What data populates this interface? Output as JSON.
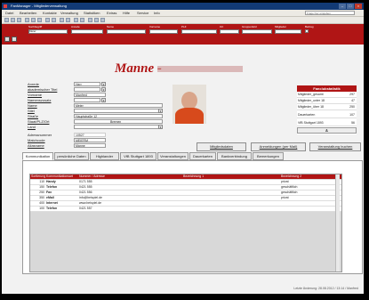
{
  "window": {
    "title": "FanManager - Mitgliederverwaltung"
  },
  "menu": [
    "Datei",
    "Bearbeiten",
    "Kontakte",
    "Verwaltung",
    "Statistiken",
    "Extras",
    "Hilfe",
    "Service",
    "Info"
  ],
  "help_placeholder": "Frage hier eingeben",
  "filters": {
    "labels": [
      "Suchbegriff",
      "Anrede",
      "Name",
      "Vorname",
      "PLZ",
      "Ort",
      "Gruppenfeld",
      "Mitglieder",
      "Beitrag"
    ],
    "values": [
      "Meier",
      "",
      "",
      "",
      "",
      "",
      "",
      "",
      ""
    ]
  },
  "header_title": "Manne -",
  "form": {
    "fields": [
      {
        "label": "Anrede",
        "value": "Herr"
      },
      {
        "label": "akademischer Titel",
        "value": ""
      },
      {
        "label": "Vorname",
        "value": "Manfred"
      },
      {
        "label": "Namenszusatz",
        "value": ""
      },
      {
        "label": "Name",
        "value": "Meier"
      },
      {
        "label": "Stiel",
        "value": ""
      },
      {
        "label": "Straße",
        "value": "Hauptstraße 12"
      },
      {
        "label": "Staat/PLZ/Ort",
        "value": "Bremen"
      },
      {
        "label": "Land",
        "value": ""
      }
    ],
    "extra": [
      {
        "label": "Adressnummer",
        "value": "10527"
      },
      {
        "label": "Matchcode",
        "value": "MEIERM"
      },
      {
        "label": "Aliasname",
        "value": "Manne"
      }
    ]
  },
  "fanclub": {
    "title": "Fanclubstatistik",
    "rows": [
      {
        "label": "Mitglieder_gesamt",
        "value": "297"
      },
      {
        "label": "Mitglieder_unter 18",
        "value": "47"
      },
      {
        "label": "Mitglieder_über 18",
        "value": "250"
      },
      {
        "label": "Dauerkarten",
        "value": "107"
      },
      {
        "label": "VfB Stuttgart 1893",
        "value": "56"
      }
    ],
    "button": "Ä"
  },
  "actions": [
    "Mitgliedsdaten",
    "Anmeldungen (per Mail)",
    "Veranstaltung buchen"
  ],
  "tabs": [
    "Kommunikation",
    "persönliche Daten",
    "Highlander",
    "VfB Stuttgart 1893",
    "Veranstaltungen",
    "Dauerkarten",
    "Bankverbindung",
    "Bemerkungen"
  ],
  "grid": {
    "headers": [
      "Sortierung",
      "Kommunikationsart",
      "Nummer / Adresse",
      "Bezeichnung 1",
      "Bezeichnung 2"
    ],
    "rows": [
      {
        "nr": "110",
        "type": "Handy",
        "addr": "0171 555",
        "b2": "privat"
      },
      {
        "nr": "150",
        "type": "Telefon",
        "addr": "0421 555",
        "b2": "geschäftlich"
      },
      {
        "nr": "250",
        "type": "Fax",
        "addr": "0421 556",
        "b2": "geschäftlich"
      },
      {
        "nr": "350",
        "type": "eMail",
        "addr": "info@beispiel.de",
        "b2": "privat"
      },
      {
        "nr": "400",
        "type": "Internet",
        "addr": "www.beispiel.de",
        "b2": ""
      },
      {
        "nr": "100",
        "type": "Telefon",
        "addr": "0421 557",
        "b2": ""
      }
    ]
  },
  "status": "Letzte Änderung: 28.08.2012 / 13:14 / Manfred",
  "colors": {
    "accent": "#b01515",
    "titlebar": "#123a75"
  }
}
